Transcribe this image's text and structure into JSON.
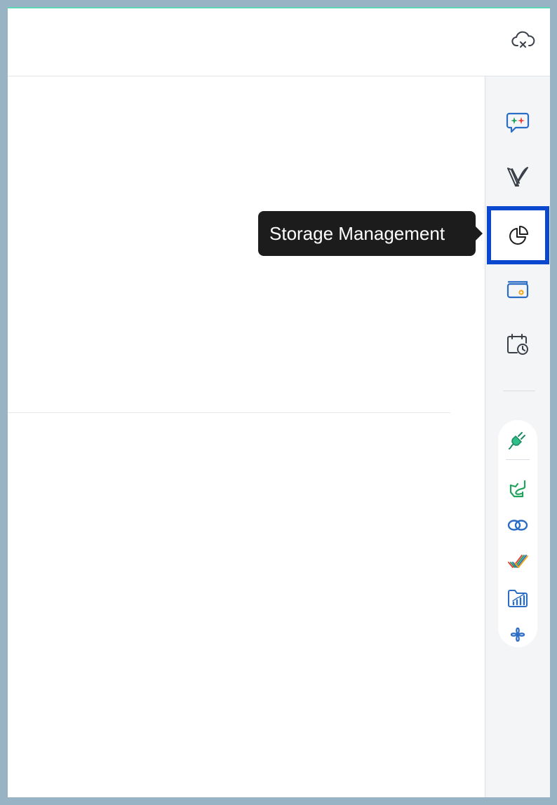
{
  "header": {
    "sync_icon": "cloud-x-icon"
  },
  "rail": {
    "items": [
      {
        "name": "chat",
        "icon": "chat-sparkle-icon"
      },
      {
        "name": "vani",
        "icon": "v-logo-icon"
      },
      {
        "name": "storage-management",
        "icon": "pie-chart-icon",
        "active": true
      },
      {
        "name": "wallet",
        "icon": "wallet-icon"
      },
      {
        "name": "schedule",
        "icon": "calendar-clock-icon"
      }
    ],
    "apps": [
      {
        "name": "integrations",
        "icon": "plug-icon"
      },
      {
        "name": "sign",
        "icon": "sign-flow-icon"
      },
      {
        "name": "cliq",
        "icon": "link-rings-icon"
      },
      {
        "name": "projects",
        "icon": "checkmarks-icon"
      },
      {
        "name": "workdrive-analytics",
        "icon": "folder-chart-icon"
      },
      {
        "name": "flow",
        "icon": "flower-knot-icon"
      }
    ]
  },
  "tooltip": {
    "text": "Storage Management"
  },
  "colors": {
    "accent_line": "#5fd6b4",
    "active_border": "#0a48cf",
    "tooltip_bg": "#1c1c1c",
    "outer_bg": "#97b3c4"
  }
}
